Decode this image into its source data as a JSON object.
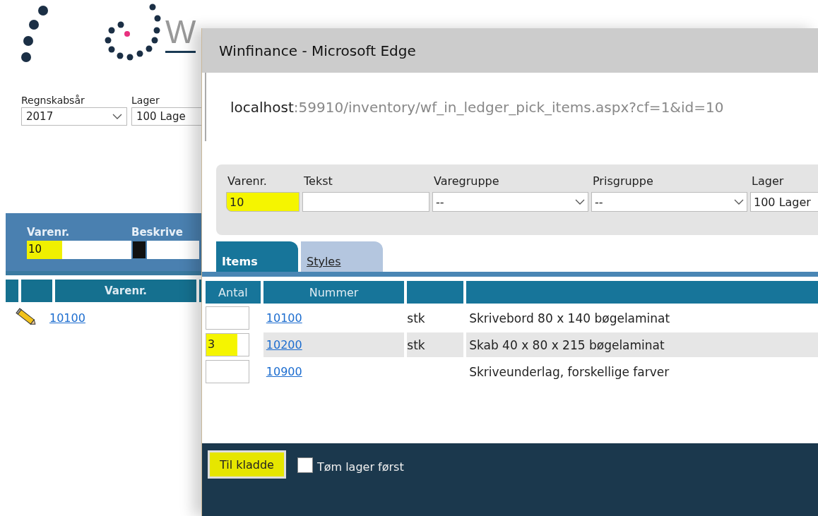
{
  "background_page": {
    "logo_text": "W",
    "filters": [
      {
        "label": "Regnskabsår",
        "value": "2017",
        "kind": "select"
      },
      {
        "label": "Lager",
        "value": "100 Lage",
        "kind": "select"
      }
    ],
    "search_fields": [
      {
        "label": "Varenr.",
        "value": "10",
        "highlighted": true,
        "kind": "text"
      },
      {
        "label": "Beskrive",
        "highlighted": false,
        "kind": "lookup"
      }
    ],
    "table": {
      "columns": [
        {},
        {},
        {
          "label": "Varenr."
        },
        {}
      ],
      "rows": [
        {
          "number": "10100"
        }
      ]
    }
  },
  "popup": {
    "title": "Winfinance - Microsoft Edge",
    "address": {
      "host": "localhost",
      "path": ":59910/inventory/wf_in_ledger_pick_items.aspx?cf=1&id=10"
    },
    "filters": [
      {
        "label": "Varenr.",
        "value": "10",
        "kind": "text",
        "highlighted": true
      },
      {
        "label": "Tekst",
        "kind": "text",
        "highlighted": false
      },
      {
        "label": "Varegruppe",
        "value": "--",
        "kind": "select",
        "highlighted": false
      },
      {
        "label": "Prisgruppe",
        "value": "--",
        "kind": "select",
        "highlighted": false
      },
      {
        "label": "Lager",
        "value": "100 Lager",
        "kind": "select",
        "highlighted": false
      }
    ],
    "tabs": [
      {
        "label": "Items",
        "selected": true
      },
      {
        "label": "Styles",
        "selected": false
      }
    ],
    "table": {
      "columns": [
        {
          "label": "Antal"
        },
        {
          "label": "Nummer"
        },
        {},
        {}
      ],
      "rows": [
        {
          "number": "10100",
          "unit": "stk",
          "text": "Skrivebord 80 x 140 bøgelaminat",
          "highlighted": false
        },
        {
          "quantity": "3",
          "number": "10200",
          "unit": "stk",
          "text": "Skab 40 x 80 x 215 bøgelaminat",
          "highlighted": true
        },
        {
          "number": "10900",
          "text": "Skriveunderlag, forskellige farver",
          "highlighted": false
        }
      ]
    },
    "footer": {
      "button": {
        "label": "Til kladde",
        "highlighted": true
      },
      "checkbox": {
        "label": "Tøm lager først",
        "checked": false
      }
    }
  }
}
